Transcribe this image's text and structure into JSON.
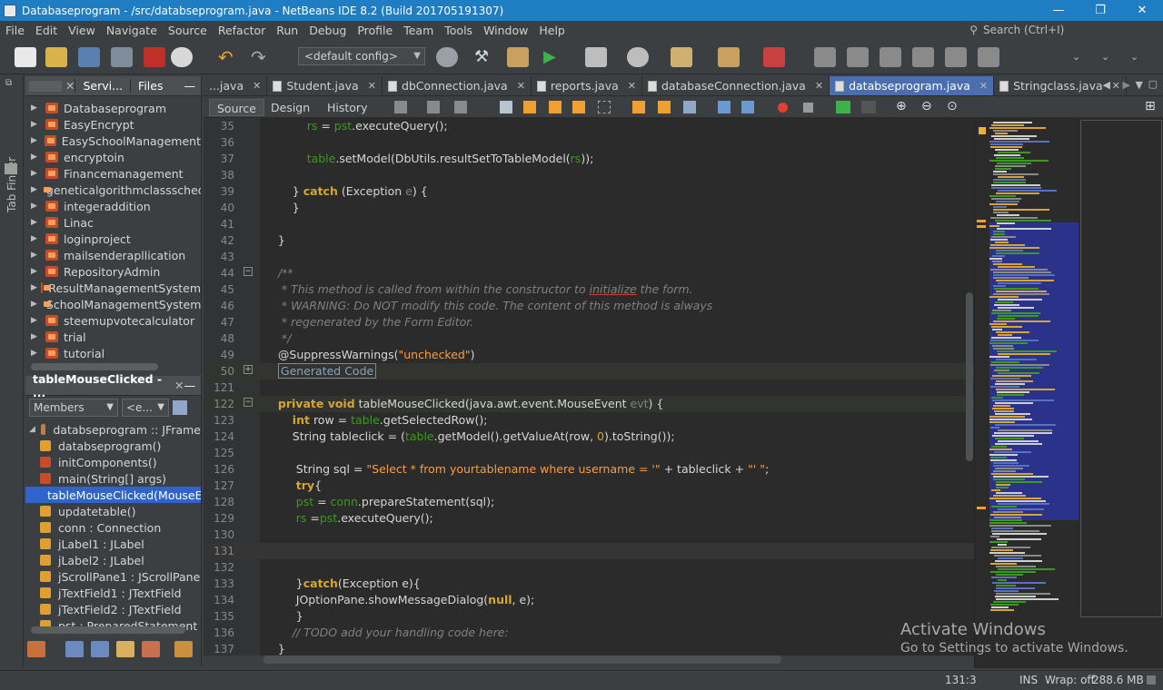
{
  "window": {
    "title": "Databaseprogram - /src/databseprogram.java - NetBeans IDE 8.2 (Build 201705191307)",
    "controls": [
      "—",
      "❐",
      "✕"
    ]
  },
  "menu": [
    "File",
    "Edit",
    "View",
    "Navigate",
    "Source",
    "Refactor",
    "Run",
    "Debug",
    "Profile",
    "Team",
    "Tools",
    "Window",
    "Help"
  ],
  "search": {
    "placeholder": "Search (Ctrl+I)"
  },
  "toolbar": {
    "config": "<default config>"
  },
  "left_strip": {
    "label": "Tab Finder"
  },
  "projects_panel": {
    "tabs": [
      "Servi...",
      "Files"
    ],
    "items": [
      "Databaseprogram",
      "EasyEncrypt",
      "EasySchoolManagement",
      "encryptoin",
      "Financemanagement",
      "geneticalgorithmclassscheduling",
      "integeraddition",
      "Linac",
      "loginproject",
      "mailsenderapllication",
      "RepositoryAdmin",
      "ResultManagementSystem",
      "SchoolManagementSystem",
      "steemupvotecalculator",
      "trial",
      "tutorial"
    ]
  },
  "navigator": {
    "title": "tableMouseClicked - ...",
    "filter": "Members",
    "filter2": "<e...",
    "root": "databseprogram :: JFrame",
    "members": [
      {
        "label": "databseprogram()",
        "color": "#e0a030"
      },
      {
        "label": "initComponents()",
        "color": "#c94c2a"
      },
      {
        "label": "main(String[] args)",
        "color": "#c94c2a"
      },
      {
        "label": "tableMouseClicked(MouseEvent evt)",
        "color": "#c94c2a"
      },
      {
        "label": "updatetable()",
        "color": "#e0a030"
      },
      {
        "label": "conn : Connection",
        "color": "#e0a030"
      },
      {
        "label": "jLabel1 : JLabel",
        "color": "#e0a030"
      },
      {
        "label": "jLabel2 : JLabel",
        "color": "#e0a030"
      },
      {
        "label": "jScrollPane1 : JScrollPane",
        "color": "#e0a030"
      },
      {
        "label": "jTextField1 : JTextField",
        "color": "#e0a030"
      },
      {
        "label": "jTextField2 : JTextField",
        "color": "#e0a030"
      },
      {
        "label": "pst : PreparedStatement",
        "color": "#e0a030"
      }
    ],
    "selected_index": 3
  },
  "editor_tabs": [
    {
      "label": "...java",
      "active": false
    },
    {
      "label": "Student.java",
      "active": false
    },
    {
      "label": "dbConnection.java",
      "active": false
    },
    {
      "label": "reports.java",
      "active": false
    },
    {
      "label": "databaseConnection.java",
      "active": false
    },
    {
      "label": "databseprogram.java",
      "active": true
    },
    {
      "label": "Stringclass.java",
      "active": false
    }
  ],
  "editor_modes": [
    "Source",
    "Design",
    "History"
  ],
  "code": {
    "line_numbers": [
      "35",
      "36",
      "37",
      "38",
      "39",
      "40",
      "41",
      "42",
      "43",
      "44",
      "45",
      "46",
      "47",
      "48",
      "49",
      "50",
      "121",
      "122",
      "123",
      "124",
      "125",
      "126",
      "127",
      "128",
      "129",
      "130",
      "131",
      "132",
      "133",
      "134",
      "135",
      "136",
      "137"
    ]
  },
  "status": {
    "position": "131:3",
    "mode": "INS",
    "wrap": "Wrap: off",
    "memory": "288.6 MB"
  },
  "watermark": {
    "line1": "Activate Windows",
    "line2": "Go to Settings to activate Windows."
  },
  "colors": {
    "title_bar": "#1f7dc3",
    "panel_bg": "#3c3f41",
    "editor_bg": "#2b2b2b",
    "active_tab": "#4b6eaf",
    "selection": "#2f65ca",
    "keyword": "#d6a533",
    "field": "#3b9a1f",
    "string": "#ff9a3c"
  }
}
